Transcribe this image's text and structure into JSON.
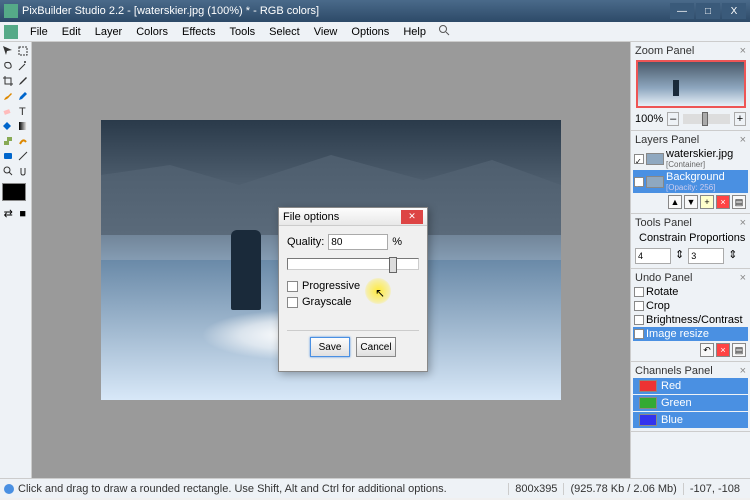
{
  "window": {
    "title": "PixBuilder Studio 2.2 - [waterskier.jpg (100%) * - RGB colors]",
    "min_label": "—",
    "max_label": "□",
    "close_label": "X"
  },
  "menu": {
    "items": [
      "File",
      "Edit",
      "Layer",
      "Colors",
      "Effects",
      "Tools",
      "Select",
      "View",
      "Options",
      "Help"
    ]
  },
  "dialog": {
    "title": "File options",
    "quality_label": "Quality:",
    "quality_value": "80",
    "quality_unit": "%",
    "progressive_label": "Progressive",
    "grayscale_label": "Grayscale",
    "save_label": "Save",
    "cancel_label": "Cancel"
  },
  "zoom_panel": {
    "title": "Zoom Panel",
    "value": "100%",
    "minus": "–",
    "plus": "+"
  },
  "layers_panel": {
    "title": "Layers Panel",
    "items": [
      {
        "name": "waterskier.jpg",
        "meta": "[Container]"
      },
      {
        "name": "Background",
        "meta": "[Opacity: 256]"
      }
    ]
  },
  "tools_panel": {
    "title": "Tools Panel",
    "constrain_label": "Constrain Proportions",
    "w": "4",
    "h": "3"
  },
  "undo_panel": {
    "title": "Undo Panel",
    "items": [
      "Rotate",
      "Crop",
      "Brightness/Contrast",
      "Image resize"
    ]
  },
  "channels_panel": {
    "title": "Channels Panel",
    "items": [
      "Red",
      "Green",
      "Blue"
    ]
  },
  "statusbar": {
    "hint": "Click and drag to draw a rounded rectangle. Use Shift, Alt and Ctrl for additional options.",
    "dims": "800x395",
    "size": "(925.78 Kb / 2.06 Mb)",
    "coords": "-107, -108"
  },
  "colors": {
    "accent": "#4a90e2",
    "red": "#e33",
    "green": "#3a3",
    "blue": "#33e"
  }
}
